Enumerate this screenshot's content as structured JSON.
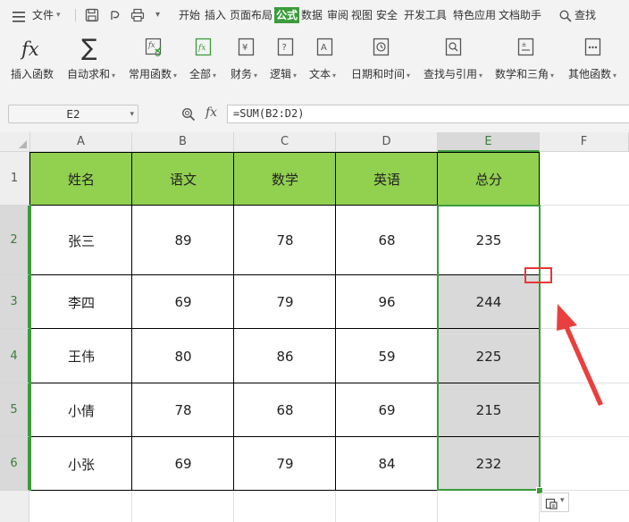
{
  "menu": {
    "file": "文件",
    "tabs": [
      "开始",
      "插入",
      "页面布局",
      "公式",
      "数据",
      "审阅",
      "视图",
      "安全",
      "开发工具",
      "特色应用",
      "文档助手"
    ],
    "active_tab": "公式",
    "search": "查找"
  },
  "toolbar": {
    "insert_function": "插入函数",
    "autosum": "自动求和",
    "common_functions": "常用函数",
    "all": "全部",
    "finance": "财务",
    "logic": "逻辑",
    "text": "文本",
    "datetime": "日期和时间",
    "lookup": "查找与引用",
    "math": "数学和三角",
    "other": "其他函数",
    "fx_symbol": "fx",
    "sigma": "∑"
  },
  "formula_bar": {
    "name_box": "E2",
    "fx_label": "fx",
    "formula": "=SUM(B2:D2)"
  },
  "sheet": {
    "columns": [
      "A",
      "B",
      "C",
      "D",
      "E",
      "F"
    ],
    "row_numbers": [
      "1",
      "2",
      "3",
      "4",
      "5",
      "6"
    ],
    "selected_column": "E",
    "header_row": [
      "姓名",
      "语文",
      "数学",
      "英语",
      "总分"
    ],
    "rows": [
      [
        "张三",
        "89",
        "78",
        "68",
        "235"
      ],
      [
        "李四",
        "69",
        "79",
        "96",
        "244"
      ],
      [
        "王伟",
        "80",
        "86",
        "59",
        "225"
      ],
      [
        "小倩",
        "78",
        "68",
        "69",
        "215"
      ],
      [
        "小张",
        "69",
        "79",
        "84",
        "232"
      ]
    ]
  },
  "colors": {
    "header_fill": "#92d050",
    "selection": "#3b9c3b",
    "annotation": "#e53935",
    "selected_fill": "#d9d9d9"
  }
}
